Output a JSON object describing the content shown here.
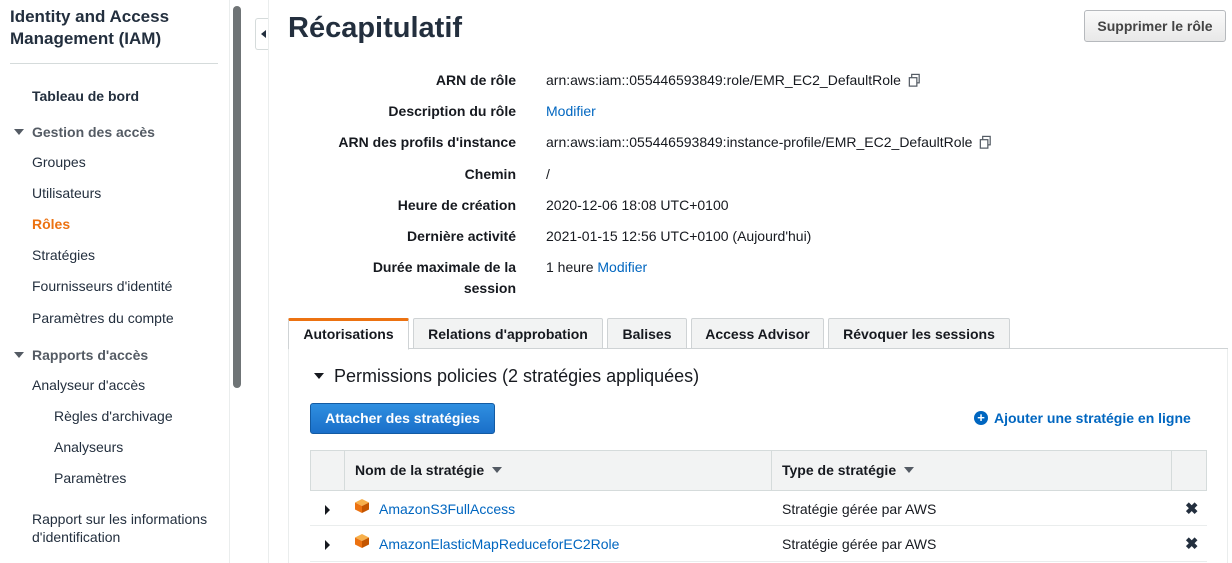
{
  "sidebar": {
    "title": "Identity and Access Management (IAM)",
    "items": [
      {
        "label": "Tableau de bord"
      },
      {
        "label": "Gestion des accès"
      },
      {
        "label": "Groupes"
      },
      {
        "label": "Utilisateurs"
      },
      {
        "label": "Rôles"
      },
      {
        "label": "Stratégies"
      },
      {
        "label": "Fournisseurs d'identité"
      },
      {
        "label": "Paramètres du compte"
      },
      {
        "label": "Rapports d'accès"
      },
      {
        "label": "Analyseur d'accès"
      },
      {
        "label": "Règles d'archivage"
      },
      {
        "label": "Analyseurs"
      },
      {
        "label": "Paramètres"
      },
      {
        "label": "Rapport sur les informations d'identification"
      }
    ]
  },
  "header": {
    "title": "Récapitulatif",
    "delete_role_label": "Supprimer le rôle"
  },
  "summary": {
    "rows": [
      {
        "label": "ARN de rôle",
        "value": "arn:aws:iam::055446593849:role/EMR_EC2_DefaultRole"
      },
      {
        "label": "Description du rôle",
        "value": "Modifier"
      },
      {
        "label": "ARN des profils d'instance",
        "value": "arn:aws:iam::055446593849:instance-profile/EMR_EC2_DefaultRole"
      },
      {
        "label": "Chemin",
        "value": "/"
      },
      {
        "label": "Heure de création",
        "value": "2020-12-06 18:08 UTC+0100"
      },
      {
        "label": "Dernière activité",
        "value": "2021-01-15 12:56 UTC+0100 (Aujourd'hui)"
      },
      {
        "label": "Durée maximale de la session",
        "value": "1 heure",
        "link": "Modifier"
      }
    ]
  },
  "tabs": [
    {
      "label": "Autorisations"
    },
    {
      "label": "Relations d'approbation"
    },
    {
      "label": "Balises"
    },
    {
      "label": "Access Advisor"
    },
    {
      "label": "Révoquer les sessions"
    }
  ],
  "permissions": {
    "title": "Permissions policies (2 stratégies appliquées)",
    "attach_label": "Attacher des stratégies",
    "add_inline_label": "Ajouter une stratégie en ligne",
    "columns": [
      "Nom de la stratégie",
      "Type de stratégie"
    ],
    "rows": [
      {
        "name": "AmazonS3FullAccess",
        "type": "Stratégie gérée par AWS"
      },
      {
        "name": "AmazonElasticMapReduceforEC2Role",
        "type": "Stratégie gérée par AWS"
      }
    ]
  },
  "colors": {
    "accent": "#ec7211",
    "link": "#0066c0",
    "primary_button": "#1a6fc9"
  }
}
